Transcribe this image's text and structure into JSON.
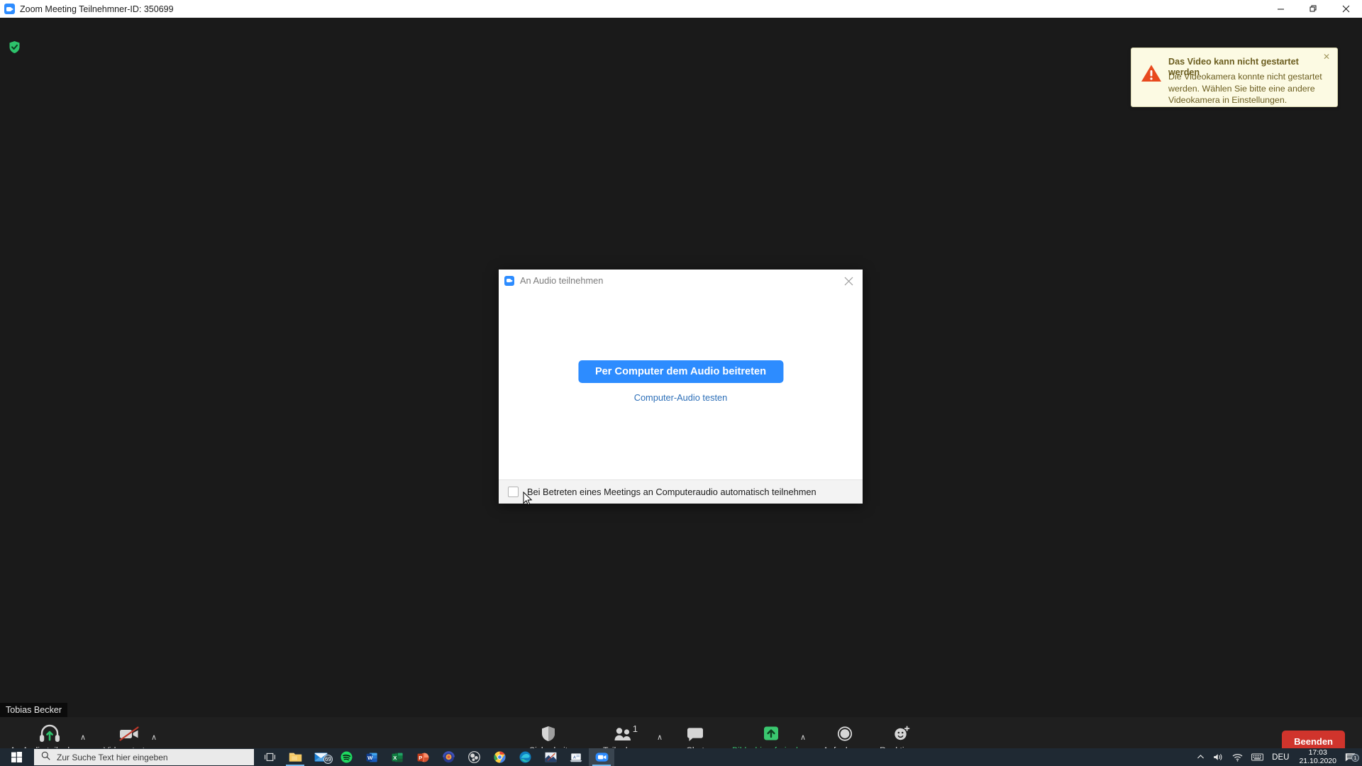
{
  "window": {
    "title": "Zoom Meeting Teilnehmner-ID: 350699",
    "minimize_label": "—",
    "restore_label": "❐",
    "close_label": "✕"
  },
  "stage": {
    "encryption_icon": "green-shield-check"
  },
  "toast": {
    "heading": "Das Video kann nicht gestartet werden",
    "body": "Die Videokamera konnte nicht gestartet werden. Wählen Sie bitte eine andere Videokamera in Einstellungen.",
    "close_label": "✕",
    "bg_color": "#fcfae3",
    "text_color": "#6b5d1f",
    "warn_color": "#e8491e"
  },
  "dialog": {
    "title": "An Audio teilnehmen",
    "close_label": "✕",
    "join_button": "Per Computer dem Audio beitreten",
    "test_link": "Computer-Audio testen",
    "checkbox_label": "Bei Betreten eines Meetings an Computeraudio automatisch teilnehmen",
    "checkbox_checked": false,
    "accent_color": "#2d8cff",
    "link_color": "#2d6fb8"
  },
  "self_view": {
    "name": "Tobias Becker"
  },
  "toolbar": {
    "audio": {
      "label": "An Audio teilnehmen",
      "icon": "headset-join-audio-icon"
    },
    "video": {
      "label": "Video starten",
      "icon": "camera-off-icon"
    },
    "security": {
      "label": "Sicherheit",
      "icon": "shield-icon"
    },
    "participants": {
      "label": "Teilnehmer",
      "count": "1",
      "icon": "people-icon"
    },
    "chat": {
      "label": "Chat",
      "icon": "speech-bubble-icon"
    },
    "share": {
      "label": "Bildschirm freigeben",
      "icon": "share-screen-icon",
      "color": "#3ac76f"
    },
    "record": {
      "label": "Aufnehmen",
      "icon": "record-circle-icon"
    },
    "reactions": {
      "label": "Reaktionen",
      "icon": "smiley-plus-icon"
    },
    "end": {
      "label": "Beenden",
      "color": "#d0342c"
    },
    "caret": "∧"
  },
  "taskbar": {
    "start_label": "start-icon",
    "search_placeholder": "Zur Suche Text hier eingeben",
    "taskview_label": "task-view-icon",
    "apps": [
      {
        "name": "file-explorer-icon",
        "badge": ""
      },
      {
        "name": "mail-icon",
        "badge": "69"
      },
      {
        "name": "spotify-icon",
        "badge": ""
      },
      {
        "name": "word-icon",
        "badge": ""
      },
      {
        "name": "excel-icon",
        "badge": ""
      },
      {
        "name": "powerpoint-icon",
        "badge": ""
      },
      {
        "name": "audio-app-icon",
        "badge": ""
      },
      {
        "name": "obs-icon",
        "badge": ""
      },
      {
        "name": "chrome-icon",
        "badge": ""
      },
      {
        "name": "edge-icon",
        "badge": ""
      },
      {
        "name": "photo-editor-icon",
        "badge": ""
      },
      {
        "name": "presentation-app-icon",
        "badge": ""
      },
      {
        "name": "zoom-icon",
        "badge": ""
      }
    ],
    "tray": {
      "chevron": "∧",
      "volume_icon": "volume-icon",
      "wifi_icon": "wifi-icon",
      "keyboard_icon": "keyboard-icon",
      "language": "DEU",
      "time": "17:03",
      "date": "21.10.2020",
      "notification_count": "1"
    }
  }
}
